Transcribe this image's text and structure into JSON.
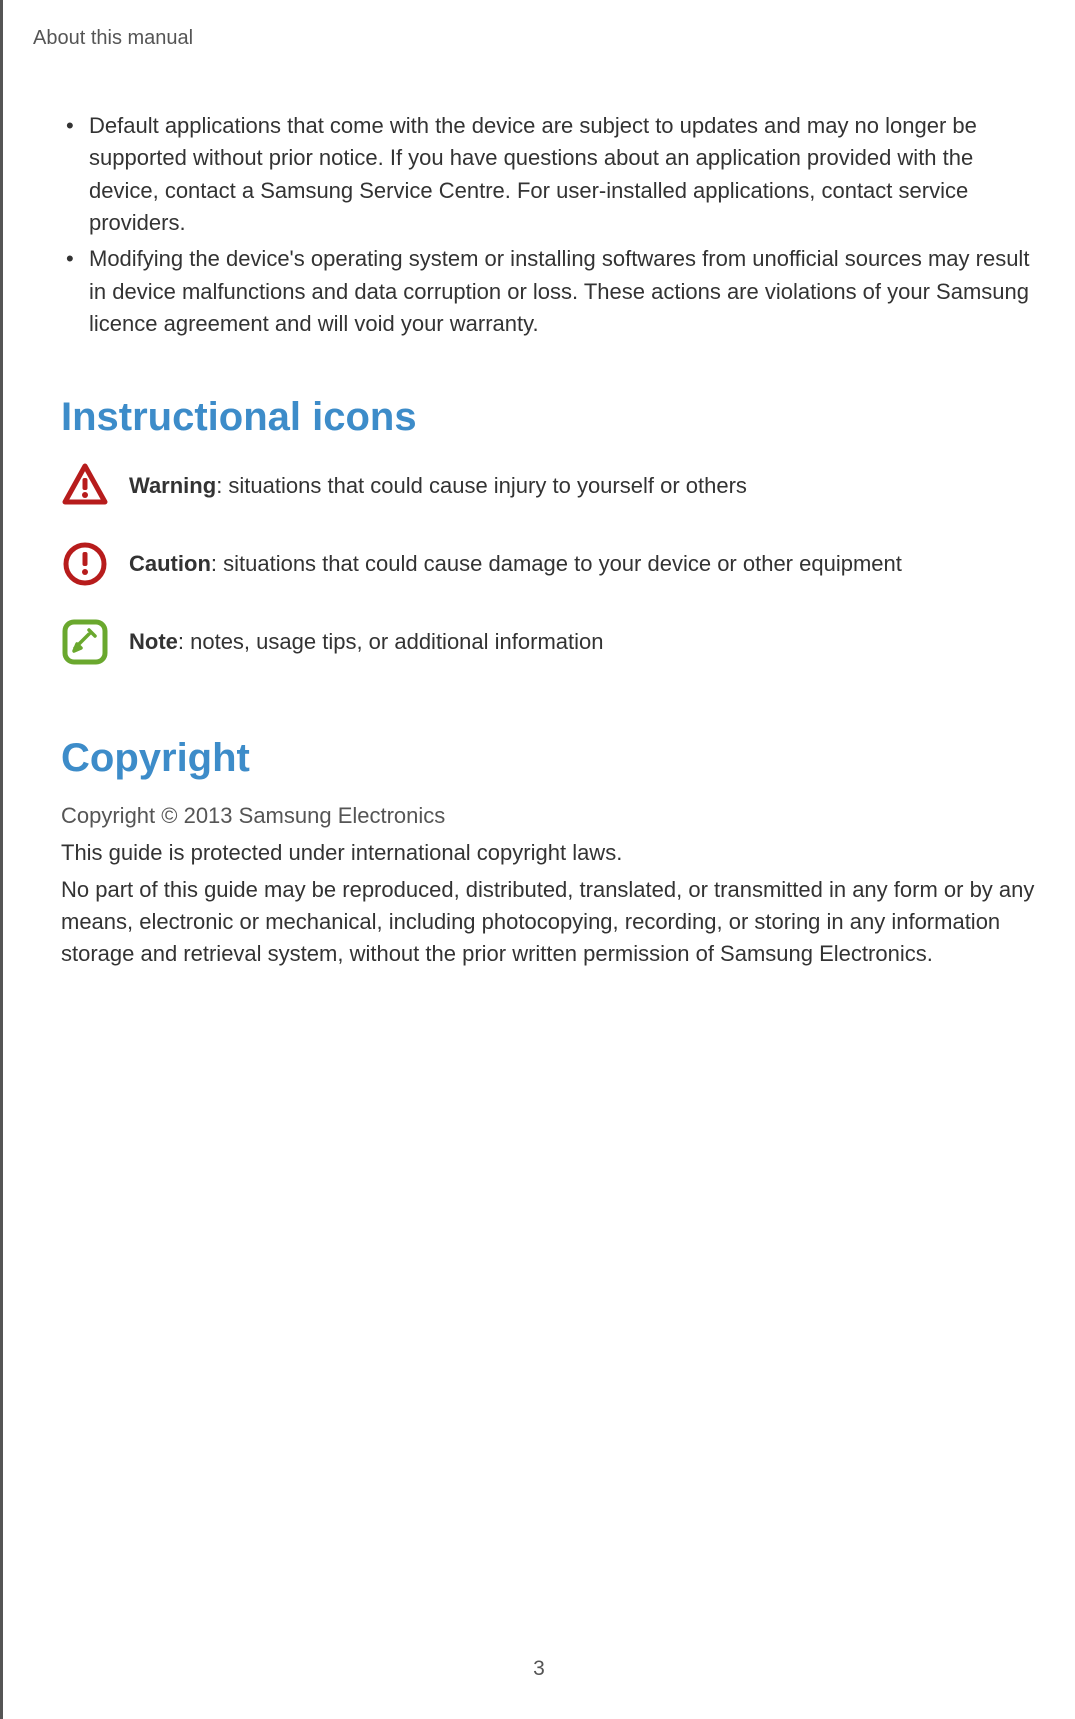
{
  "header": {
    "title": "About this manual"
  },
  "bullets": [
    "Default applications that come with the device are subject to updates and may no longer be supported without prior notice. If you have questions about an application provided with the device, contact a Samsung Service Centre. For user-installed applications, contact service providers.",
    "Modifying the device's operating system or installing softwares from unofficial sources may result in device malfunctions and data corruption or loss. These actions are violations of your Samsung licence agreement and will void your warranty."
  ],
  "sections": {
    "icons_heading": "Instructional icons",
    "copyright_heading": "Copyright"
  },
  "icon_items": [
    {
      "label": "Warning",
      "text": ": situations that could cause injury to yourself or others"
    },
    {
      "label": "Caution",
      "text": ": situations that could cause damage to your device or other equipment"
    },
    {
      "label": "Note",
      "text": ": notes, usage tips, or additional information"
    }
  ],
  "copyright": {
    "subtitle": "Copyright © 2013 Samsung Electronics",
    "line1": "This guide is protected under international copyright laws.",
    "line2": "No part of this guide may be reproduced, distributed, translated, or transmitted in any form or by any means, electronic or mechanical, including photocopying, recording, or storing in any information storage and retrieval system, without the prior written permission of Samsung Electronics."
  },
  "page_number": "3"
}
